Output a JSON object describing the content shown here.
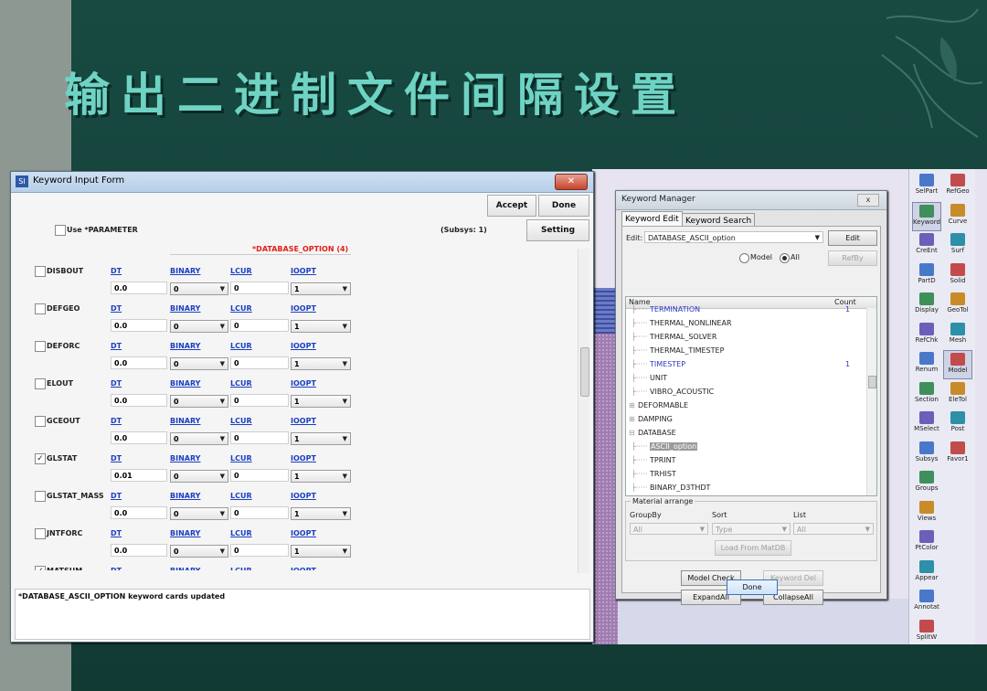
{
  "slide": {
    "title": "输出二进制文件间隔设置"
  },
  "kif": {
    "window_title": "Keyword Input Form",
    "accept_label": "Accept",
    "done_label": "Done",
    "setting_label": "Setting",
    "use_parameter_label": "Use *PARAMETER",
    "subsys_label": "(Subsys: 1)",
    "keyword_header": "*DATABASE_OPTION  (4)",
    "column_headers": [
      "DT",
      "BINARY",
      "LCUR",
      "IOOPT"
    ],
    "rows": [
      {
        "name": "DISBOUT",
        "checked": false,
        "dt": "0.0",
        "binary": "0",
        "lcur": "0",
        "ioopt": "1"
      },
      {
        "name": "DEFGEO",
        "checked": false,
        "dt": "0.0",
        "binary": "0",
        "lcur": "0",
        "ioopt": "1"
      },
      {
        "name": "DEFORC",
        "checked": false,
        "dt": "0.0",
        "binary": "0",
        "lcur": "0",
        "ioopt": "1"
      },
      {
        "name": "ELOUT",
        "checked": false,
        "dt": "0.0",
        "binary": "0",
        "lcur": "0",
        "ioopt": "1"
      },
      {
        "name": "GCEOUT",
        "checked": false,
        "dt": "0.0",
        "binary": "0",
        "lcur": "0",
        "ioopt": "1"
      },
      {
        "name": "GLSTAT",
        "checked": true,
        "dt": "0.01",
        "binary": "0",
        "lcur": "0",
        "ioopt": "1"
      },
      {
        "name": "GLSTAT_MASS",
        "checked": false,
        "dt": "0.0",
        "binary": "0",
        "lcur": "0",
        "ioopt": "1"
      },
      {
        "name": "JNTFORC",
        "checked": false,
        "dt": "0.0",
        "binary": "0",
        "lcur": "0",
        "ioopt": "1"
      }
    ],
    "partial_row": {
      "name": "MATSUM",
      "dt": "DT",
      "binary": "BINARY",
      "lcur": "LCUR",
      "ioopt": "IOOPT"
    },
    "message": "*DATABASE_ASCII_OPTION keyword cards updated"
  },
  "km": {
    "window_title": "Keyword Manager",
    "close_label": "x",
    "tabs": [
      "Keyword Edit",
      "Keyword Search"
    ],
    "edit_label": "Edit:",
    "edit_value": "DATABASE_ASCII_option",
    "edit_button": "Edit",
    "refby_button": "RefBy",
    "radio_model": "Model",
    "radio_all": "All",
    "col_name": "Name",
    "col_count": "Count",
    "tree": [
      {
        "label": "TERMINATION",
        "count": "1",
        "blue": true
      },
      {
        "label": "THERMAL_NONLINEAR",
        "count": "",
        "blue": false
      },
      {
        "label": "THERMAL_SOLVER",
        "count": "",
        "blue": false
      },
      {
        "label": "THERMAL_TIMESTEP",
        "count": "",
        "blue": false
      },
      {
        "label": "TIMESTEP",
        "count": "1",
        "blue": true
      },
      {
        "label": "UNIT",
        "count": "",
        "blue": false
      },
      {
        "label": "VIBRO_ACOUSTIC",
        "count": "",
        "blue": false
      },
      {
        "label": "DEFORMABLE",
        "count": "",
        "blue": false
      },
      {
        "label": "DAMPING",
        "count": "",
        "blue": false
      },
      {
        "label": "DATABASE",
        "count": "",
        "blue": false
      },
      {
        "label": "ASCII_option",
        "count": "",
        "blue": false
      },
      {
        "label": "TPRINT",
        "count": "",
        "blue": false
      },
      {
        "label": "TRHIST",
        "count": "",
        "blue": false
      },
      {
        "label": "BINARY_D3THDT",
        "count": "",
        "blue": false
      }
    ],
    "material_arrange": "Material arrange",
    "groupby_label": "GroupBy",
    "sort_label": "Sort",
    "list_label": "List",
    "groupby_value": "All",
    "sort_value": "Type",
    "list_value": "All",
    "load_matdb": "Load From MatDB",
    "model_check": "Model Check",
    "keyword_del": "Keyword Del",
    "expand_all": "ExpandAll",
    "collapse_all": "CollapseAll",
    "done": "Done"
  },
  "toolbar": {
    "items": [
      "SelPart",
      "RefGeo",
      "Keyword",
      "Curve",
      "CreEnt",
      "Surf",
      "PartD",
      "Solid",
      "Display",
      "GeoTol",
      "RefChk",
      "Mesh",
      "Renum",
      "Model",
      "Section",
      "EleTol",
      "MSelect",
      "Post",
      "Subsys",
      "Favor1",
      "Groups",
      "Views",
      "PtColor",
      "Appear",
      "Annotat",
      "SplitW"
    ]
  },
  "colors": {
    "title": "#6fd3c4",
    "background": "#17453d",
    "link_blue": "#1b3fc0",
    "keyword_red": "#e0201a"
  }
}
